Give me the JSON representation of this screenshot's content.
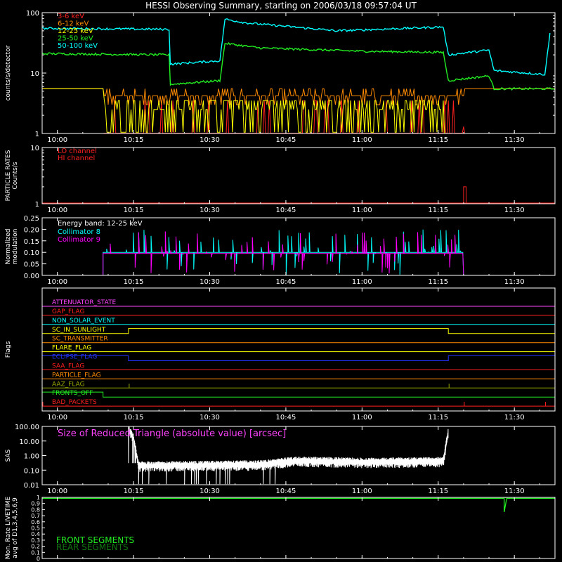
{
  "title": "HESSI Observing Summary, starting on 2006/03/18 09:57:04 UT",
  "x_ticks": [
    "10:00",
    "10:15",
    "10:30",
    "10:45",
    "11:00",
    "11:15",
    "11:30"
  ],
  "colors": {
    "axis": "#ffffff",
    "bg": "#000000"
  },
  "chart_data": [
    {
      "type": "line",
      "panel": "count rates",
      "ylabel": "counts/s/detector",
      "yscale": "log",
      "ylim": [
        1,
        100
      ],
      "y_ticks": [
        "100",
        "10",
        "1"
      ],
      "x_unit": "UT time",
      "xlim": [
        "09:57",
        "11:38"
      ],
      "series": [
        {
          "name": "3-6 keV",
          "color": "#ff2020",
          "x": [
            "09:57",
            "10:09",
            "10:09",
            "11:20",
            "11:20",
            "11:38"
          ],
          "values": [
            1,
            1,
            1.3,
            1.3,
            1,
            1
          ]
        },
        {
          "name": "6-12 keV",
          "color": "#ff8c00",
          "x": [
            "09:57",
            "10:09",
            "10:09",
            "11:20",
            "11:20",
            "11:38"
          ],
          "values": [
            5.5,
            5.5,
            4.2,
            4.2,
            5.5,
            5.5
          ]
        },
        {
          "name": "12-25 keV",
          "color": "#ffff00",
          "x": [
            "09:57",
            "10:09",
            "10:09",
            "11:16",
            "11:16",
            "11:38"
          ],
          "values": [
            5.5,
            5.5,
            3.5,
            3.5,
            1,
            1
          ]
        },
        {
          "name": "25-50 keV",
          "color": "#22ee22",
          "x": [
            "09:57",
            "10:22",
            "10:22",
            "10:32",
            "10:33",
            "10:40",
            "11:00",
            "11:16",
            "11:17",
            "11:25",
            "11:26",
            "11:38"
          ],
          "values": [
            21,
            20,
            6.5,
            7.5,
            31,
            26,
            23,
            22,
            7.5,
            9,
            5.5,
            5.5
          ]
        },
        {
          "name": "50-100 keV",
          "color": "#00ffff",
          "x": [
            "09:57",
            "10:22",
            "10:22",
            "10:32",
            "10:33",
            "10:37",
            "10:55",
            "11:16",
            "11:17",
            "11:25",
            "11:26",
            "11:36",
            "11:37"
          ],
          "values": [
            55,
            53,
            14,
            16,
            78,
            68,
            50,
            58,
            20,
            24,
            11,
            9.5,
            45
          ]
        }
      ]
    },
    {
      "type": "line",
      "panel": "particle rates",
      "ylabel": "PARTICLE RATES Counts/s",
      "yscale": "log",
      "ylim": [
        1,
        10
      ],
      "y_ticks": [
        "10",
        "1"
      ],
      "series": [
        {
          "name": "LO channel",
          "color": "#ff2020",
          "x": [
            "09:57",
            "11:38"
          ],
          "values": [
            1,
            1
          ]
        },
        {
          "name": "HI channel",
          "color": "#ff2020",
          "x": [
            "11:20",
            "11:20",
            "11:20.5",
            "11:20.5"
          ],
          "values": [
            1,
            2,
            2,
            1
          ]
        }
      ]
    },
    {
      "type": "line",
      "panel": "modulation",
      "ylabel": "Normalized modulation",
      "ylim": [
        0,
        0.25
      ],
      "y_ticks": [
        "0.25",
        "0.20",
        "0.15",
        "0.10",
        "0.05",
        "0.00"
      ],
      "annotation": "Energy band: 12-25 keV",
      "series": [
        {
          "name": "Collimator 8",
          "color": "#00ffff",
          "baseline": 0.1,
          "x_start": "10:09",
          "x_end": "11:20"
        },
        {
          "name": "Collimator 9",
          "color": "#ff00ff",
          "baseline": 0.095,
          "x_start": "10:09",
          "x_end": "11:20"
        }
      ]
    },
    {
      "type": "line",
      "panel": "flags",
      "ylabel": "Flags",
      "series": [
        {
          "name": "ATTENUATOR_STATE",
          "color": "#ff44ff"
        },
        {
          "name": "GAP_FLAG",
          "color": "#ff2020"
        },
        {
          "name": "NON_SOLAR_EVENT",
          "color": "#00ffff"
        },
        {
          "name": "SC_IN_SUNLIGHT",
          "color": "#ffff00",
          "high_from": "10:14",
          "high_to": "11:17"
        },
        {
          "name": "SC_TRANSMITTER",
          "color": "#ff8c00"
        },
        {
          "name": "FLARE_FLAG",
          "color": "#ffff00"
        },
        {
          "name": "ECLIPSE_FLAG",
          "color": "#2233ff",
          "low_from": "10:14",
          "low_to": "11:17"
        },
        {
          "name": "SAA_FLAG",
          "color": "#ff2020"
        },
        {
          "name": "PARTICLE_FLAG",
          "color": "#ff8c00"
        },
        {
          "name": "AAZ_FLAG",
          "color": "#99aa00",
          "spikes": [
            "10:14",
            "11:17"
          ]
        },
        {
          "name": "FRONTS_OFF",
          "color": "#22ee22",
          "high_to": "10:09"
        },
        {
          "name": "BAD_PACKETS",
          "color": "#ff2020",
          "spikes": [
            "09:57",
            "11:20",
            "11:36"
          ]
        }
      ]
    },
    {
      "type": "line",
      "panel": "SAS",
      "ylabel": "SAS",
      "yscale": "log",
      "ylim": [
        0.01,
        100
      ],
      "y_ticks": [
        "100.00",
        "10.00",
        "1.00",
        "0.10",
        "0.01"
      ],
      "annotation": "Size of Reduced Triangle (absolute value) [arcsec]",
      "series": [
        {
          "name": "SAS",
          "color": "#ffffff",
          "x": [
            "10:14",
            "10:15",
            "10:16",
            "10:40",
            "10:47",
            "11:00",
            "11:16",
            "11:17"
          ],
          "values": [
            80,
            20,
            0.25,
            0.3,
            0.55,
            0.45,
            0.5,
            60
          ]
        }
      ]
    },
    {
      "type": "line",
      "panel": "livetime",
      "ylabel": "Mon. Rate LIVETIME avg of D1,3,4,5,6,9",
      "ylim": [
        0,
        1
      ],
      "y_ticks": [
        "1",
        "0.9",
        "0.8",
        "0.7",
        "0.6",
        "0.5",
        "0.4",
        "0.3",
        "0.2",
        "0.1",
        "0"
      ],
      "series": [
        {
          "name": "FRONT SEGMENTS",
          "color": "#22ee22",
          "x": [
            "09:57",
            "11:28",
            "11:28",
            "11:28.5",
            "11:38"
          ],
          "values": [
            0.985,
            0.985,
            0.76,
            0.985,
            0.985
          ]
        },
        {
          "name": "REAR SEGMENTS",
          "color": "#117711",
          "x": [
            "09:57",
            "11:38"
          ],
          "values": [
            0.995,
            0.995
          ]
        }
      ]
    }
  ]
}
